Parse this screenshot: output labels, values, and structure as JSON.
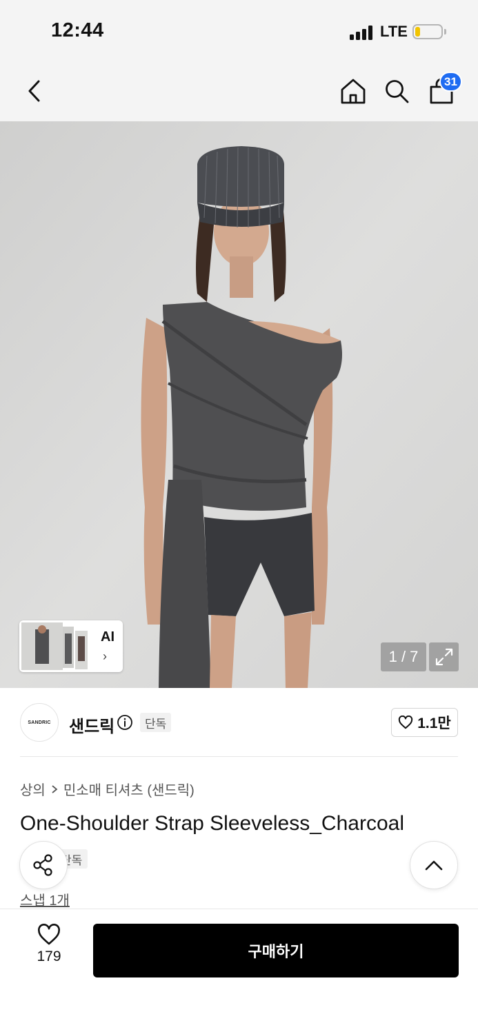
{
  "status_bar": {
    "time": "12:44",
    "network": "LTE",
    "battery_level": 0.2
  },
  "nav": {
    "cart_count": "31",
    "icons": [
      "back-icon",
      "home-icon",
      "search-icon",
      "cart-icon"
    ]
  },
  "hero": {
    "pager_text": "1 / 7",
    "ai_label": "AI",
    "ai_chevron": "›"
  },
  "brand": {
    "logo_text": "SANDRIC",
    "name": "샌드릭",
    "badge": "단독",
    "likes": "1.1만"
  },
  "product": {
    "breadcrumb": [
      "상의",
      "민소매 티셔츠 (샌드릭)"
    ],
    "title": "One-Shoulder Strap Sleeveless_Charcoal",
    "tag": "단독",
    "snap_link": "스냅 1개"
  },
  "bottom": {
    "wish_count": "179",
    "buy_label": "구매하기"
  }
}
